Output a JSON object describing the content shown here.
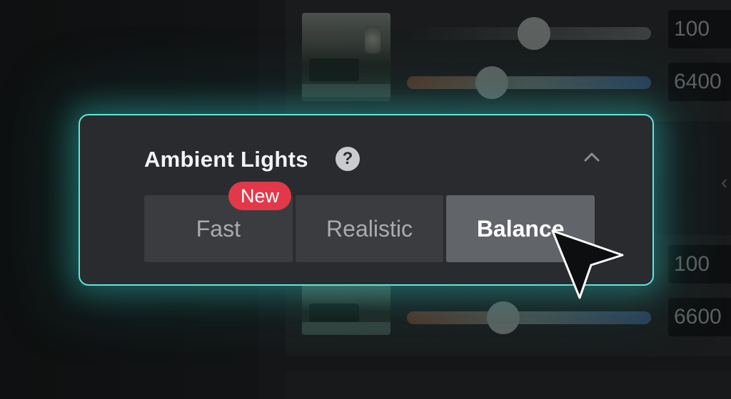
{
  "background": {
    "top_card": {
      "brightness_value": "100",
      "temperature_value": "6400"
    },
    "bottom_card": {
      "brightness_value": "100",
      "temperature_value": "6600"
    }
  },
  "panel": {
    "title": "Ambient Lights",
    "help_icon": "question-mark-icon",
    "help_glyph": "?",
    "collapse_icon": "chevron-up-icon",
    "badge": "New",
    "modes": [
      {
        "label": "Fast",
        "active": false
      },
      {
        "label": "Realistic",
        "active": false
      },
      {
        "label": "Balance",
        "active": true
      }
    ]
  },
  "colors": {
    "accent": "#5fe6dc",
    "badge": "#e2384a",
    "panel_bg": "#2a2b2e"
  }
}
